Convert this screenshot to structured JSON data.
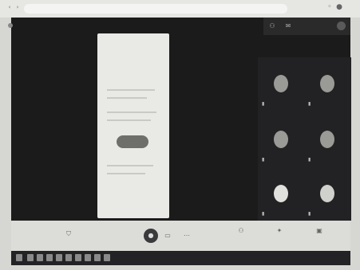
{
  "browser": {
    "url": ""
  },
  "meeting": {
    "title": ""
  },
  "top_right": {
    "time": ""
  },
  "participants": [
    {
      "name": ""
    },
    {
      "name": ""
    },
    {
      "name": ""
    },
    {
      "name": ""
    },
    {
      "name": ""
    },
    {
      "name": ""
    }
  ],
  "bottom_bar": {
    "meeting_code": "",
    "controls": [
      {
        "label": ""
      },
      {
        "label": ""
      },
      {
        "label": ""
      }
    ]
  },
  "taskbar": {
    "clock": ""
  },
  "colors": {
    "meet_background": "#1b1b1c",
    "present_button": "#6e6e6b"
  },
  "icons": [
    "shield-icon",
    "microphone-icon",
    "camera-icon",
    "present-icon",
    "people-icon",
    "activities-icon",
    "chat-icon",
    "more-icon"
  ]
}
